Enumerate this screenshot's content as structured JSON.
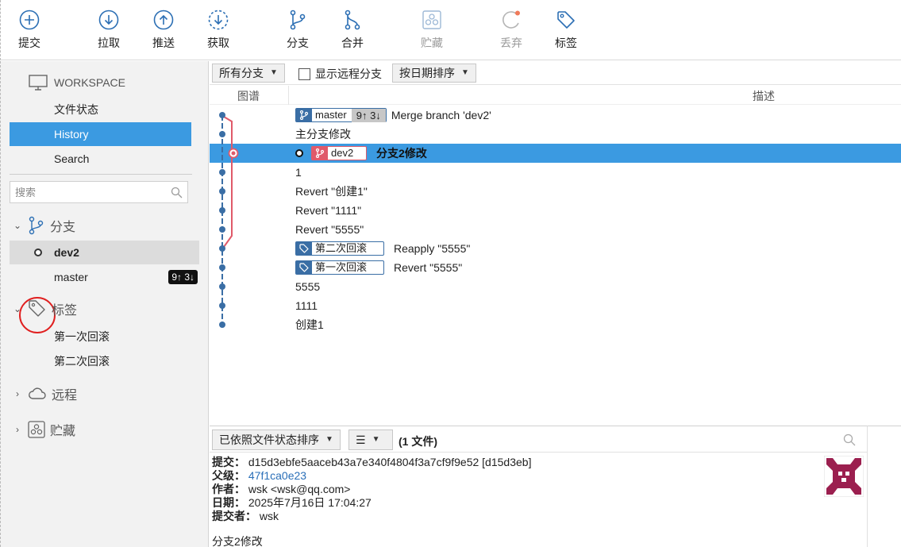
{
  "toolbar": {
    "commit": "提交",
    "pull": "拉取",
    "push": "推送",
    "fetch": "获取",
    "branch": "分支",
    "merge": "合并",
    "stash": "贮藏",
    "discard": "丢弃",
    "tag": "标签"
  },
  "sidebar": {
    "workspace_title": "WORKSPACE",
    "nav": [
      "文件状态",
      "History",
      "Search"
    ],
    "search_placeholder": "搜索",
    "branches_title": "分支",
    "branches": [
      {
        "name": "dev2",
        "current": true
      },
      {
        "name": "master",
        "ahead_behind": "9↑ 3↓"
      }
    ],
    "tags_title": "标签",
    "tags": [
      "第一次回滚",
      "第二次回滚"
    ],
    "remotes_title": "远程",
    "stashes_title": "贮藏"
  },
  "filter": {
    "branch_select": "所有分支",
    "show_remote": "显示远程分支",
    "sort_select": "按日期排序"
  },
  "columns": {
    "graph": "图谱",
    "description": "描述"
  },
  "commits": [
    {
      "desc": "Merge branch 'dev2'",
      "ref": "master",
      "ab": "9↑ 3↓"
    },
    {
      "desc": "主分支修改"
    },
    {
      "desc": "分支2修改",
      "ref": "dev2",
      "selected": true
    },
    {
      "desc": "1"
    },
    {
      "desc": "Revert \"创建1\""
    },
    {
      "desc": "Revert \"1111\""
    },
    {
      "desc": "Revert \"5555\""
    },
    {
      "desc": "Reapply \"5555\"",
      "tag": "第二次回滚"
    },
    {
      "desc": "Revert \"5555\"",
      "tag": "第一次回滚"
    },
    {
      "desc": "5555"
    },
    {
      "desc": "1111"
    },
    {
      "desc": "创建1"
    }
  ],
  "details": {
    "sort_select": "已依照文件状态排序",
    "file_count": "(1 文件)",
    "commit_label": "提交：",
    "commit_value": "d15d3ebfe5aaceb43a7e340f4804f3a7cf9f9e52 [d15d3eb]",
    "parent_label": "父级：",
    "parent_value": "47f1ca0e23",
    "author_label": "作者：",
    "author_value": "wsk <wsk@qq.com>",
    "date_label": "日期：",
    "date_value": "2025年7月16日 17:04:27",
    "committer_label": "提交者：",
    "committer_value": "wsk",
    "message": "分支2修改"
  },
  "colors": {
    "accent": "#3b9ae1",
    "graph_blue": "#3a6ea5",
    "graph_red": "#e05a6a",
    "annotation": "#e02020"
  }
}
